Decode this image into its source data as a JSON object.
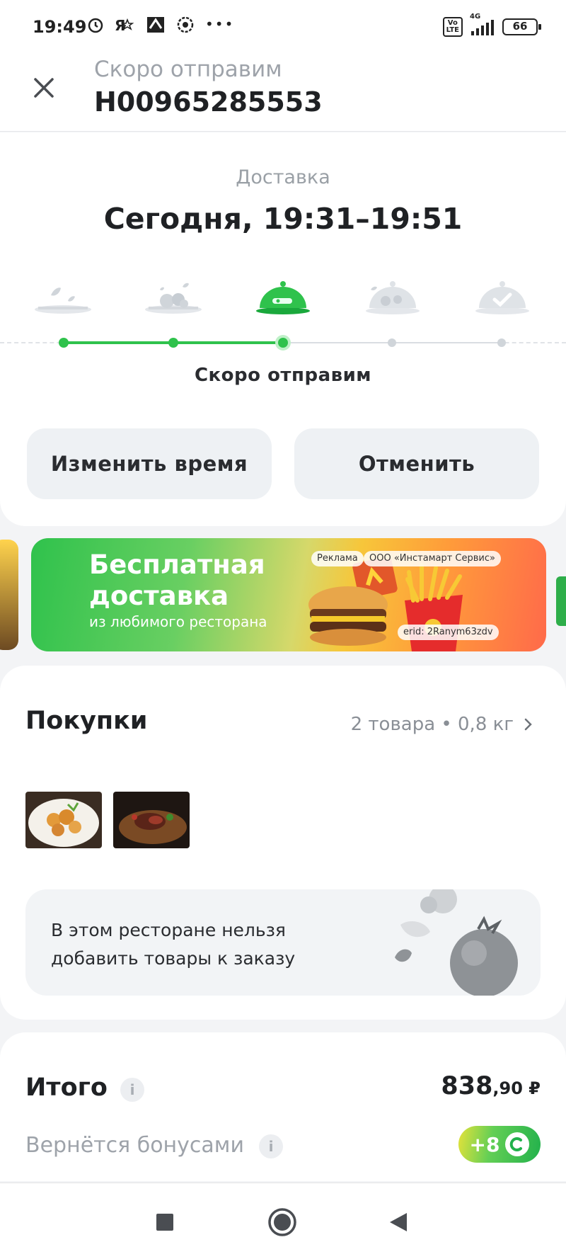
{
  "status_bar": {
    "time": "19:49",
    "network": "4G",
    "battery": "66",
    "volte": "Vo\nLTE",
    "more": "•••"
  },
  "header": {
    "subtitle": "Скоро отправим",
    "order_number": "Н00965285553"
  },
  "delivery": {
    "label": "Доставка",
    "time": "Сегодня, 19:31–19:51",
    "stages_completed": 3,
    "stages_total": 5,
    "current_status": "Скоро отправим"
  },
  "actions": {
    "change_time": "Изменить время",
    "cancel": "Отменить"
  },
  "banner": {
    "title": "Бесплатная доставка",
    "subtitle": "из любимого ресторана",
    "ad_label": "Реклама",
    "advertiser": "ООО «Инстамарт Сервис»",
    "erid": "erid: 2Ranym63zdv"
  },
  "purchases": {
    "title": "Покупки",
    "summary": "2 товара • 0,8 кг",
    "note": "В этом ресторане нельзя добавить товары к заказу"
  },
  "total": {
    "title": "Итого",
    "price_main": "838",
    "price_fraction": ",90 ₽",
    "bonus_label": "Вернётся бонусами",
    "bonus_amount": "+8",
    "info": "i"
  },
  "colors": {
    "accent_green": "#2fc24c",
    "inactive": "#d9dde2",
    "text_dark": "#1f2124",
    "text_muted": "#9ea3aa"
  },
  "icons": [
    "close-icon",
    "dish-icon",
    "cloche-icon",
    "check-icon",
    "chevron-right-icon",
    "info-icon",
    "coin-icon",
    "alarm-icon",
    "nav-square-icon",
    "nav-circle-icon",
    "nav-back-icon"
  ]
}
